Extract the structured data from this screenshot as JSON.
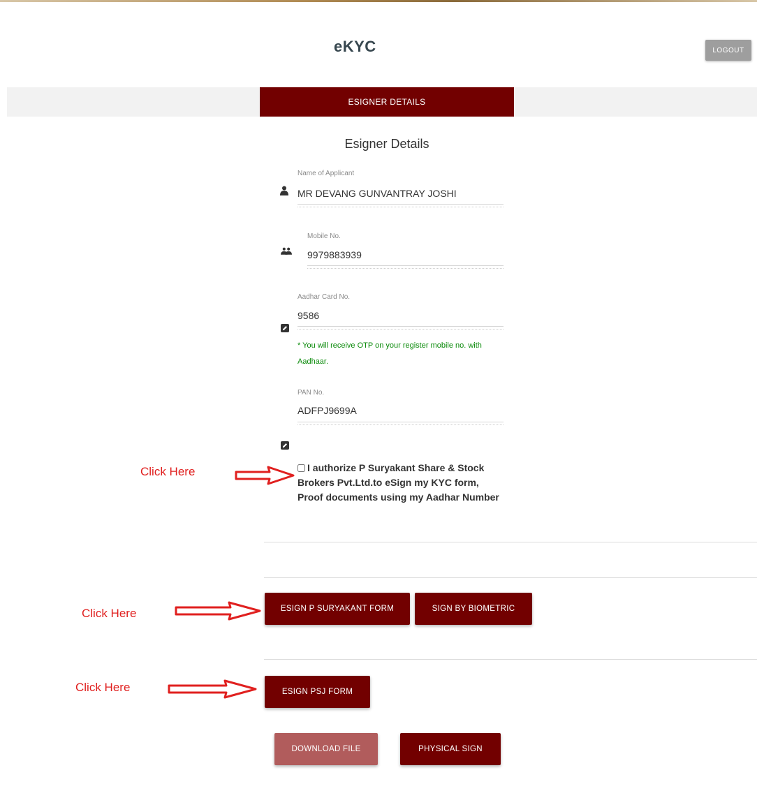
{
  "header": {
    "title": "eKYC",
    "logout_label": "LOGOUT"
  },
  "tabs": [
    {
      "label": "ESIGNER DETAILS",
      "active": true
    }
  ],
  "form": {
    "title": "Esigner Details",
    "name": {
      "label": "Name of Applicant",
      "value": "MR DEVANG GUNVANTRAY JOSHI",
      "icon": "user-icon"
    },
    "mobile": {
      "label": "Mobile No.",
      "value": "9979883939",
      "icon": "users-icon"
    },
    "aadhar": {
      "label": "Aadhar Card No.",
      "value": "9586",
      "icon": "edit-icon"
    },
    "hint": "* You will receive OTP on your register mobile no. with Aadhaar.",
    "pan": {
      "label": "PAN No.",
      "value": "ADFPJ9699A",
      "icon": "edit-icon"
    },
    "consent": "I authorize P Suryakant Share & Stock Brokers Pvt.Ltd.to eSign my KYC form, Proof documents using my Aadhar Number"
  },
  "annotations": {
    "click_here": "Click Here",
    "arrow_color": "#e0201f"
  },
  "buttons": {
    "esign_suryakant": "ESIGN P SURYAKANT FORM",
    "sign_biometric": "SIGN BY BIOMETRIC",
    "esign_psj": "ESIGN PSJ FORM",
    "download_file": "DOWNLOAD FILE",
    "physical_sign": "PHYSICAL SIGN"
  },
  "colors": {
    "primary": "#720000",
    "primary_light": "#b15c5c",
    "hint_green": "#0a8a0a"
  }
}
